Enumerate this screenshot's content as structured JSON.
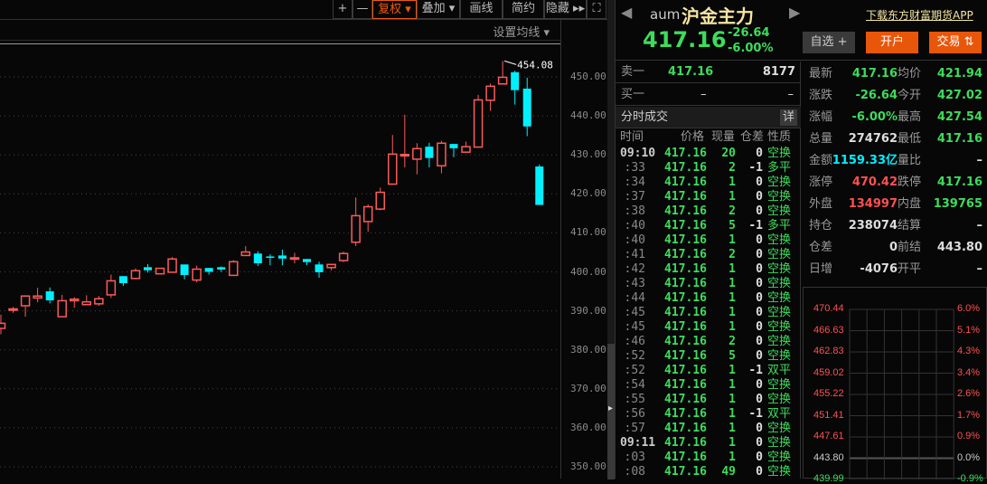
{
  "toolbar": {
    "plus": "+",
    "minus": "—",
    "fuquan": "复权 ▾",
    "overlay": "叠加 ▾",
    "draw": "画线",
    "simple": "简约",
    "hide": "隐藏 ▸▸",
    "fullscreen": "⛶"
  },
  "ma_settings": "设置均线 ▾",
  "price_axis": [
    "450.00",
    "440.00",
    "430.00",
    "420.00",
    "410.00",
    "400.00",
    "390.00",
    "380.00",
    "370.00",
    "360.00",
    "350.00"
  ],
  "header": {
    "code": "aum",
    "name": "沪金主力",
    "download_link": "下载东方财富期货APP",
    "price": "417.16",
    "change": "-26.64",
    "change_pct": "-6.00%",
    "watch_btn": "自选 +",
    "open_account_btn": "开户",
    "trade_btn": "交易 ⇅"
  },
  "orderbook": {
    "sell_label": "卖一",
    "sell_price": "417.16",
    "sell_vol": "8177",
    "buy_label": "买一",
    "buy_price": "–",
    "buy_vol": "–"
  },
  "ticks": {
    "title": "分时成交",
    "detail_btn": "详",
    "headers": [
      "时间",
      "价格",
      "现量",
      "仓差",
      "性质"
    ],
    "rows": [
      [
        "09:10",
        "417.16",
        "20",
        "0",
        "空换"
      ],
      [
        ":33",
        "417.16",
        "2",
        "-1",
        "多平"
      ],
      [
        ":34",
        "417.16",
        "1",
        "0",
        "空换"
      ],
      [
        ":37",
        "417.16",
        "1",
        "0",
        "空换"
      ],
      [
        ":38",
        "417.16",
        "2",
        "0",
        "空换"
      ],
      [
        ":40",
        "417.16",
        "5",
        "-1",
        "多平"
      ],
      [
        ":40",
        "417.16",
        "1",
        "0",
        "空换"
      ],
      [
        ":41",
        "417.16",
        "2",
        "0",
        "空换"
      ],
      [
        ":42",
        "417.16",
        "1",
        "0",
        "空换"
      ],
      [
        ":43",
        "417.16",
        "1",
        "0",
        "空换"
      ],
      [
        ":44",
        "417.16",
        "1",
        "0",
        "空换"
      ],
      [
        ":45",
        "417.16",
        "1",
        "0",
        "空换"
      ],
      [
        ":45",
        "417.16",
        "1",
        "0",
        "空换"
      ],
      [
        ":46",
        "417.16",
        "2",
        "0",
        "空换"
      ],
      [
        ":52",
        "417.16",
        "5",
        "0",
        "空换"
      ],
      [
        ":52",
        "417.16",
        "1",
        "-1",
        "双平"
      ],
      [
        ":54",
        "417.16",
        "1",
        "0",
        "空换"
      ],
      [
        ":55",
        "417.16",
        "1",
        "0",
        "空换"
      ],
      [
        ":56",
        "417.16",
        "1",
        "-1",
        "双平"
      ],
      [
        ":57",
        "417.16",
        "1",
        "0",
        "空换"
      ],
      [
        "09:11",
        "417.16",
        "1",
        "0",
        "空换"
      ],
      [
        ":03",
        "417.16",
        "1",
        "0",
        "空换"
      ],
      [
        ":08",
        "417.16",
        "49",
        "0",
        "空换"
      ]
    ]
  },
  "stats": [
    [
      "最新",
      "417.16",
      "g",
      "均价",
      "421.94",
      "g"
    ],
    [
      "涨跌",
      "-26.64",
      "g",
      "今开",
      "427.02",
      "g"
    ],
    [
      "涨幅",
      "-6.00%",
      "g",
      "最高",
      "427.54",
      "g"
    ],
    [
      "总量",
      "274762",
      "w",
      "最低",
      "417.16",
      "g"
    ],
    [
      "金额",
      "1159.33亿",
      "c",
      "量比",
      "–",
      "w"
    ],
    [
      "涨停",
      "470.42",
      "r",
      "跌停",
      "417.16",
      "g"
    ],
    [
      "外盘",
      "134997",
      "r",
      "内盘",
      "139765",
      "g"
    ],
    [
      "持仓",
      "238074",
      "w",
      "结算",
      "–",
      "w"
    ],
    [
      "仓差",
      "0",
      "w",
      "前结",
      "443.80",
      "w"
    ],
    [
      "日增",
      "-4076",
      "w",
      "开平",
      "–",
      "w"
    ]
  ],
  "mini_chart": {
    "left": [
      "470.44",
      "466.63",
      "462.83",
      "459.02",
      "455.22",
      "451.41",
      "447.61",
      "443.80",
      "439.99"
    ],
    "right": [
      "6.0%",
      "5.1%",
      "4.3%",
      "3.4%",
      "2.6%",
      "1.7%",
      "0.9%",
      "0.0%",
      "-0.9%"
    ]
  },
  "chart_data": {
    "type": "candlestick",
    "ylim": [
      348,
      457
    ],
    "high_label": "454.08",
    "colors": {
      "up": "#ff5a5a",
      "down": "#00f0ff"
    },
    "candles": [
      [
        385.5,
        386.8,
        389,
        384
      ],
      [
        390.4,
        390.5,
        391,
        389.5
      ],
      [
        391.3,
        393.8,
        394,
        388.5
      ],
      [
        393.3,
        393.8,
        395.9,
        392.2
      ],
      [
        395,
        392.7,
        396,
        391.9
      ],
      [
        388.5,
        392.6,
        394.1,
        388.5
      ],
      [
        392.6,
        393,
        393.5,
        390.8
      ],
      [
        391.6,
        392.3,
        394,
        391.6
      ],
      [
        391.8,
        393.1,
        393.8,
        391.3
      ],
      [
        394.1,
        397.7,
        399.3,
        393.3
      ],
      [
        398.9,
        397.1,
        398.9,
        396.4
      ],
      [
        398.3,
        400.3,
        400.9,
        398.1
      ],
      [
        401.2,
        400.4,
        402,
        399.8
      ],
      [
        399.5,
        400.9,
        400.9,
        399.5
      ],
      [
        399.9,
        403.3,
        403.8,
        399.9
      ],
      [
        401.9,
        399.2,
        401.9,
        398.1
      ],
      [
        397.9,
        400.7,
        401.6,
        397.3
      ],
      [
        401,
        400,
        401,
        399.3
      ],
      [
        401.2,
        400.6,
        401.4,
        400
      ],
      [
        399.1,
        402.6,
        403,
        399.1
      ],
      [
        404.2,
        405.1,
        406.6,
        404.2
      ],
      [
        404.7,
        402.2,
        405.3,
        401.5
      ],
      [
        403.95,
        403.9,
        404.5,
        401.7
      ],
      [
        404.2,
        403.4,
        405.7,
        401.7
      ],
      [
        403.55,
        403.6,
        404.9,
        402.2
      ],
      [
        403.3,
        402.5,
        403.3,
        401.7
      ],
      [
        401.9,
        399.9,
        402.6,
        398.5
      ],
      [
        401.1,
        401.9,
        401.9,
        400.4
      ],
      [
        402.9,
        404.7,
        405.2,
        402.5
      ],
      [
        407.6,
        414.4,
        419.1,
        406.6
      ],
      [
        412.9,
        416.7,
        417.3,
        410.3
      ],
      [
        416.1,
        420.4,
        421.6,
        415.8
      ],
      [
        422.5,
        430.2,
        435.1,
        422.5
      ],
      [
        430.0,
        430.1,
        440.3,
        426.8
      ],
      [
        428.9,
        431.6,
        433,
        425
      ],
      [
        432.1,
        429.2,
        433.1,
        426.8
      ],
      [
        427.2,
        433,
        433.6,
        425.3
      ],
      [
        432.8,
        431.7,
        432.8,
        429.4
      ],
      [
        430.7,
        432.1,
        433.4,
        430.7
      ],
      [
        432,
        444.1,
        445.4,
        432
      ],
      [
        444,
        447.6,
        448.3,
        441.3
      ],
      [
        448.2,
        449.9,
        454.08,
        448.2
      ],
      [
        451.2,
        446.6,
        451.6,
        442.9
      ],
      [
        447,
        437.3,
        449.8,
        434.8
      ],
      [
        427.02,
        417.16,
        427.54,
        417.16
      ]
    ]
  }
}
